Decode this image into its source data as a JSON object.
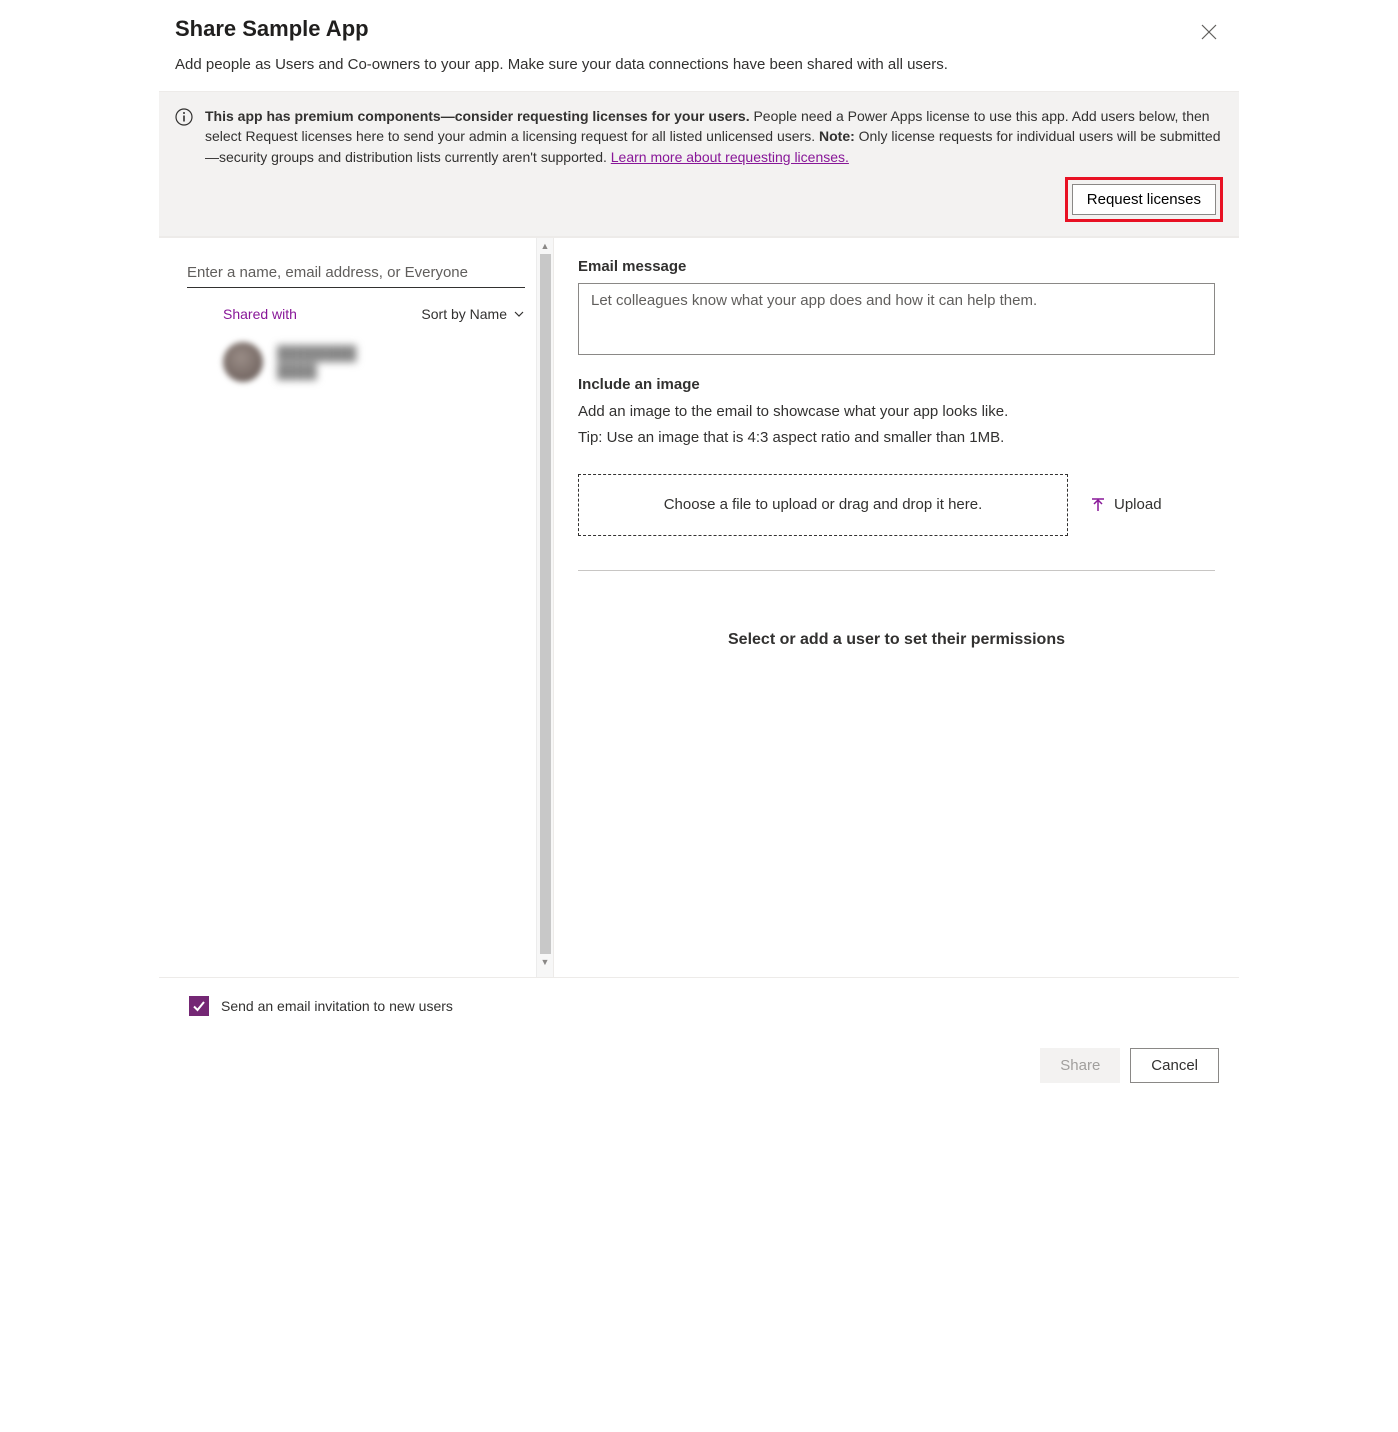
{
  "header": {
    "title": "Share Sample App",
    "subtitle": "Add people as Users and Co-owners to your app. Make sure your data connections have been shared with all users."
  },
  "banner": {
    "bold_intro": "This app has premium components—consider requesting licenses for your users.",
    "text_part1": " People need a Power Apps license to use this app. Add users below, then select Request licenses here to send your admin a licensing request for all listed unlicensed users. ",
    "note_label": "Note:",
    "note_text": " Only license requests for individual users will be submitted—security groups and distribution lists currently aren't supported. ",
    "link_text": "Learn more about requesting licenses.",
    "button_label": "Request licenses"
  },
  "left": {
    "search_placeholder": "Enter a name, email address, or Everyone",
    "shared_with_label": "Shared with",
    "sort_label": "Sort by Name",
    "user_name": "████████",
    "user_sub": "████"
  },
  "right": {
    "email_label": "Email message",
    "email_placeholder": "Let colleagues know what your app does and how it can help them.",
    "image_label": "Include an image",
    "image_desc_line1": "Add an image to the email to showcase what your app looks like.",
    "image_desc_line2": "Tip: Use an image that is 4:3 aspect ratio and smaller than 1MB.",
    "dropzone_text": "Choose a file to upload or drag and drop it here.",
    "upload_label": "Upload",
    "perm_prompt": "Select or add a user to set their permissions"
  },
  "footer": {
    "email_invite_label": "Send an email invitation to new users",
    "share_label": "Share",
    "cancel_label": "Cancel"
  }
}
